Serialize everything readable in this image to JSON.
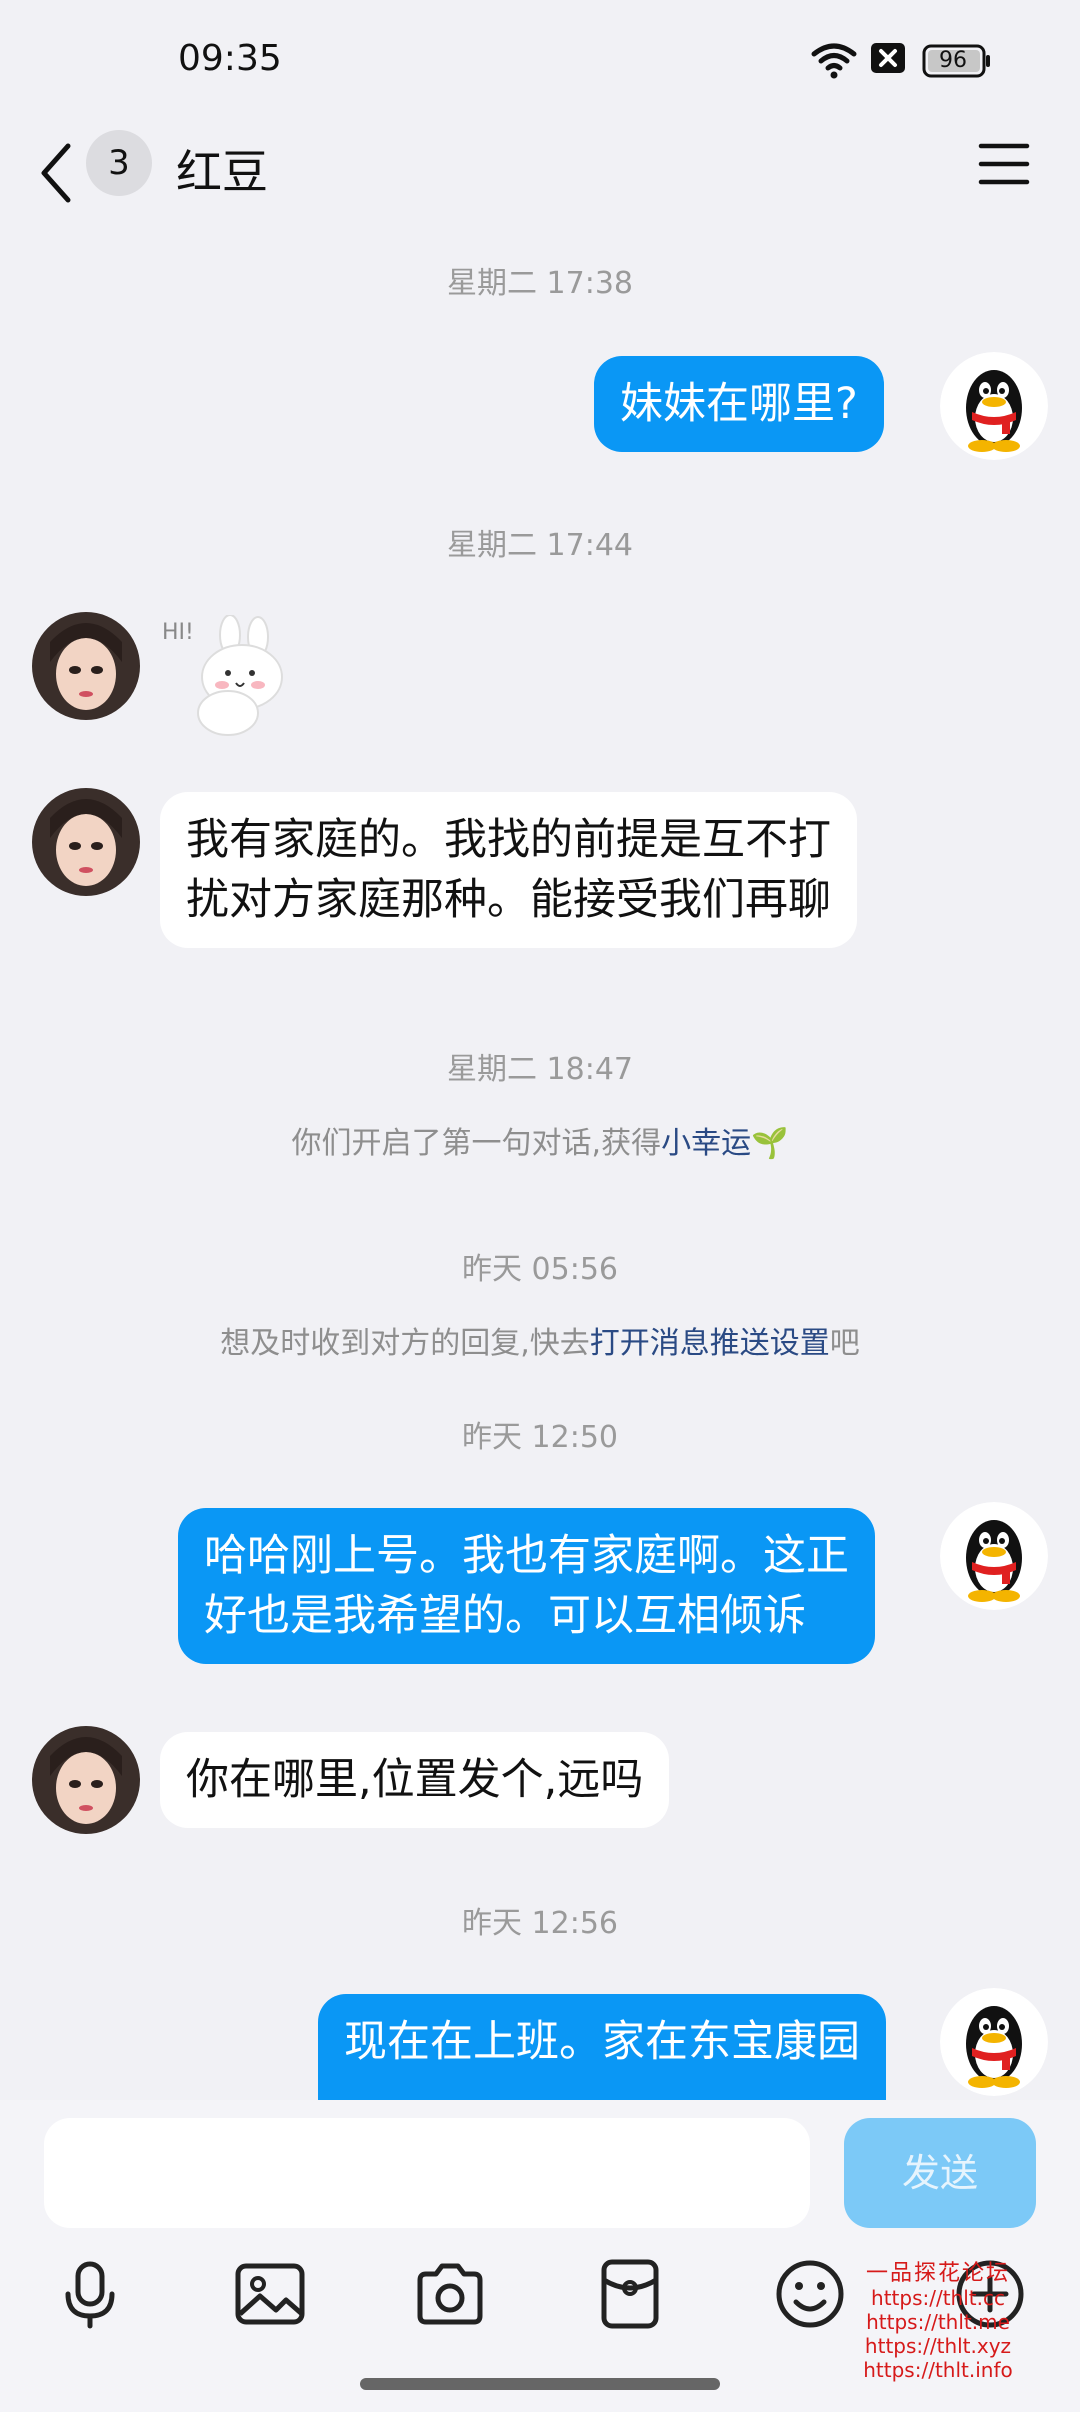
{
  "status_bar": {
    "time": "09:35",
    "battery": "96"
  },
  "header": {
    "back_label": "back",
    "unread_count": "3",
    "title": "红豆"
  },
  "messages": [
    {
      "time": "星期二 17:38"
    },
    {
      "text": "妹妹在哪里?"
    },
    {
      "time": "星期二 17:44"
    },
    {
      "sticker": "HI!"
    },
    {
      "text_line1": "我有家庭的。我找的前提是互不打",
      "text_line2": "扰对方家庭那种。能接受我们再聊"
    },
    {
      "time": "星期二 18:47",
      "system_prefix": "你们开启了第一句对话,获得",
      "system_link": "小幸运"
    },
    {
      "time": "昨天 05:56",
      "system_prefix": "想及时收到对方的回复,快去",
      "system_link": "打开消息推送设置",
      "system_suffix": "吧"
    },
    {
      "time": "昨天 12:50"
    },
    {
      "text_line1": "哈哈刚上号。我也有家庭啊。这正",
      "text_line2": "好也是我希望的。可以互相倾诉"
    },
    {
      "text": "你在哪里,位置发个,远吗"
    },
    {
      "time": "昨天 12:56"
    },
    {
      "text": "现在在上班。家在东宝康园"
    }
  ],
  "input": {
    "value": "",
    "send_label": "发送"
  },
  "toolbar": [
    "microphone-icon",
    "image-icon",
    "camera-icon",
    "red-packet-icon",
    "emoji-icon",
    "plus-icon"
  ],
  "watermark": {
    "title": "一品探花论坛",
    "lines": [
      "https://thlt.cc",
      "https://thlt.me",
      "https://thlt.xyz",
      "https://thlt.info"
    ]
  },
  "colors": {
    "background": "#f1f1f5",
    "outgoing_bubble": "#0a97f5",
    "incoming_bubble": "#ffffff",
    "send_button": "#7cc9f7",
    "link": "#2a4a84"
  }
}
